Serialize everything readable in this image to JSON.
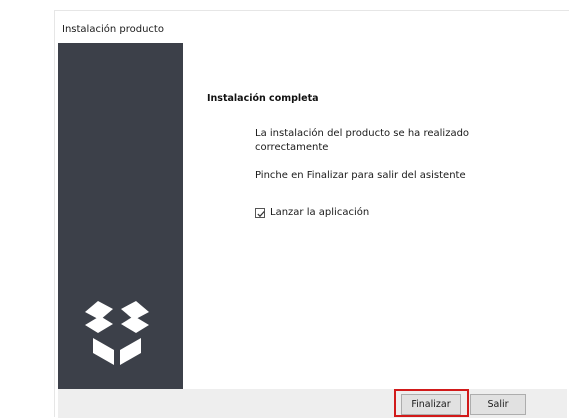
{
  "window": {
    "title": "Instalación producto"
  },
  "sidebar": {
    "logo_icon": "open-box-icon",
    "color": "#3c4049"
  },
  "content": {
    "heading": "Instalación completa",
    "message_1": "La instalación del producto se ha realizado correctamente",
    "message_2": "Pinche en Finalizar para salir del asistente",
    "launch_checkbox": {
      "label": "Lanzar la aplicación",
      "checked": true
    }
  },
  "footer": {
    "finish_label": "Finalizar",
    "exit_label": "Salir",
    "highlight_color": "#d11a1a"
  }
}
